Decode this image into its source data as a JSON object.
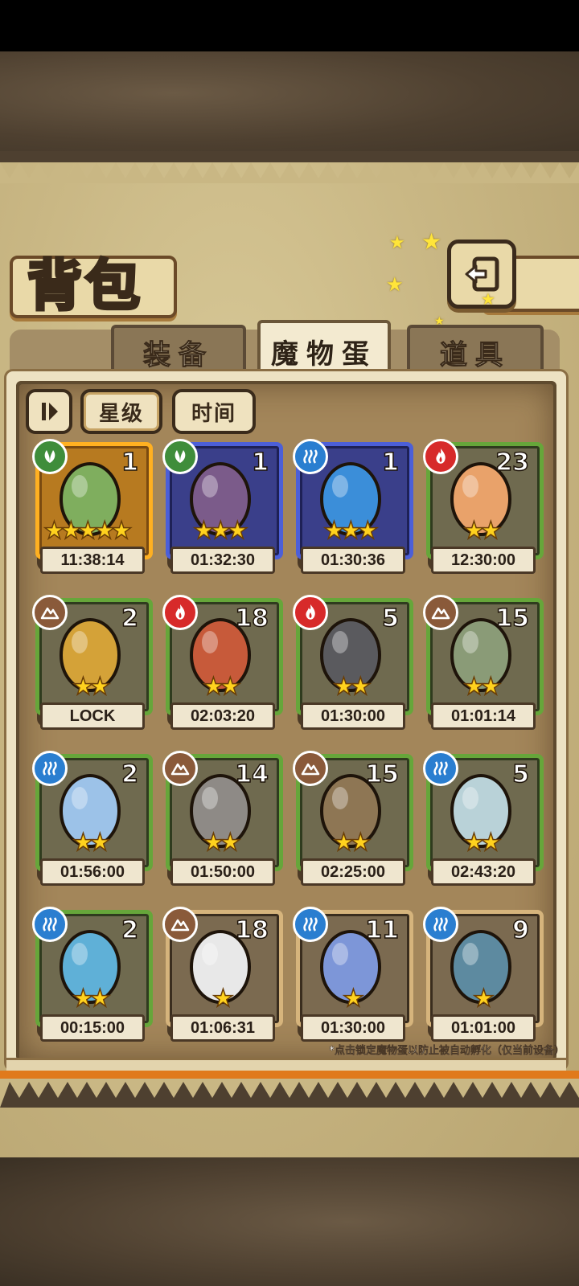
{
  "title": "背包",
  "tabs": [
    {
      "label": "装备",
      "active": false
    },
    {
      "label": "魔物蛋",
      "active": true
    },
    {
      "label": "道具",
      "active": false
    }
  ],
  "controls": {
    "sort_icon": "sort-toggle-icon",
    "star_label": "星级",
    "time_label": "时间"
  },
  "eggs": [
    {
      "element": "leaf",
      "count": "1",
      "stars": 5,
      "timer": "11:38:14",
      "frame": "orange",
      "egg_color": "#7fae5e"
    },
    {
      "element": "leaf",
      "count": "1",
      "stars": 3,
      "timer": "01:32:30",
      "frame": "blue",
      "egg_color": "#7b5b8a"
    },
    {
      "element": "water",
      "count": "1",
      "stars": 3,
      "timer": "01:30:36",
      "frame": "blue",
      "egg_color": "#3b8ed9"
    },
    {
      "element": "fire",
      "count": "23",
      "stars": 2,
      "timer": "12:30:00",
      "frame": "green",
      "egg_color": "#e9a26a"
    },
    {
      "element": "earth",
      "count": "2",
      "stars": 2,
      "timer": "LOCK",
      "frame": "green",
      "egg_color": "#d4a238"
    },
    {
      "element": "fire",
      "count": "18",
      "stars": 2,
      "timer": "02:03:20",
      "frame": "green",
      "egg_color": "#c75a3a"
    },
    {
      "element": "fire",
      "count": "5",
      "stars": 2,
      "timer": "01:30:00",
      "frame": "green",
      "egg_color": "#5a5a5e"
    },
    {
      "element": "earth",
      "count": "15",
      "stars": 2,
      "timer": "01:01:14",
      "frame": "green",
      "egg_color": "#8a9b77"
    },
    {
      "element": "water",
      "count": "2",
      "stars": 2,
      "timer": "01:56:00",
      "frame": "green",
      "egg_color": "#9cc2e8"
    },
    {
      "element": "earth",
      "count": "14",
      "stars": 2,
      "timer": "01:50:00",
      "frame": "green",
      "egg_color": "#8e8a86"
    },
    {
      "element": "earth",
      "count": "15",
      "stars": 2,
      "timer": "02:25:00",
      "frame": "green",
      "egg_color": "#8e7654"
    },
    {
      "element": "water",
      "count": "5",
      "stars": 2,
      "timer": "02:43:20",
      "frame": "green",
      "egg_color": "#b9d2d8"
    },
    {
      "element": "water",
      "count": "2",
      "stars": 2,
      "timer": "00:15:00",
      "frame": "green",
      "egg_color": "#5fb0d7"
    },
    {
      "element": "earth",
      "count": "18",
      "stars": 1,
      "timer": "01:06:31",
      "frame": "tan",
      "egg_color": "#e8e8e8"
    },
    {
      "element": "water",
      "count": "11",
      "stars": 1,
      "timer": "01:30:00",
      "frame": "tan",
      "egg_color": "#7d96d8"
    },
    {
      "element": "water",
      "count": "9",
      "stars": 1,
      "timer": "01:01:00",
      "frame": "tan",
      "egg_color": "#5d8aa0"
    }
  ],
  "element_colors": {
    "leaf": "#3f8d3b",
    "water": "#2a7ed0",
    "fire": "#d72a2a",
    "earth": "#8a5a3a"
  },
  "note": "*点击锁定魔物蛋以防止被自动孵化（仅当前设备）"
}
